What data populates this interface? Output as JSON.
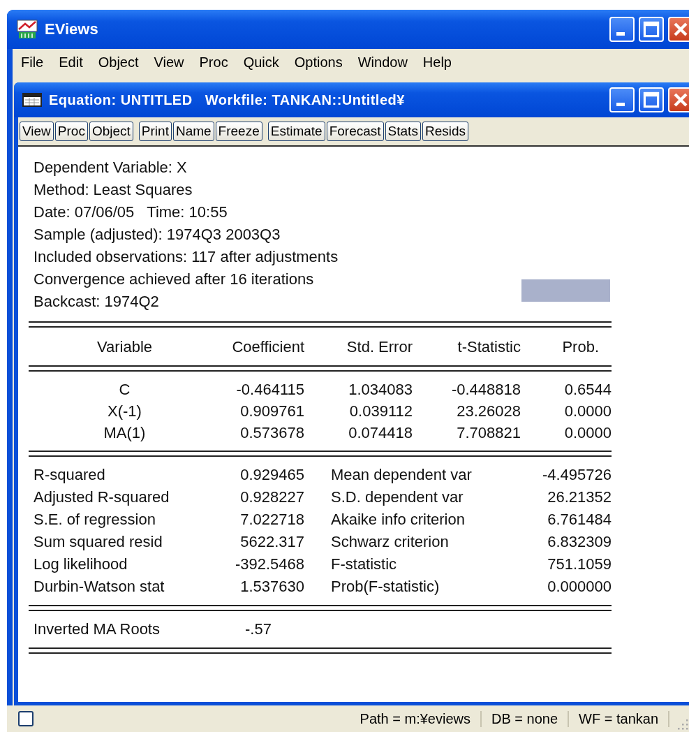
{
  "window": {
    "title": "EViews"
  },
  "menu": [
    {
      "label": "File"
    },
    {
      "label": "Edit"
    },
    {
      "label": "Object"
    },
    {
      "label": "View"
    },
    {
      "label": "Proc"
    },
    {
      "label": "Quick"
    },
    {
      "label": "Options"
    },
    {
      "label": "Window"
    },
    {
      "label": "Help"
    }
  ],
  "equation_window": {
    "title": "Equation: UNTITLED   Workfile: TANKAN::Untitled¥",
    "toolbar": [
      [
        "View",
        "Proc",
        "Object"
      ],
      [
        "Print",
        "Name",
        "Freeze"
      ],
      [
        "Estimate",
        "Forecast",
        "Stats",
        "Resids"
      ]
    ],
    "header_lines": [
      "Dependent Variable: X",
      "Method: Least Squares",
      "Date: 07/06/05   Time: 10:55",
      "Sample (adjusted): 1974Q3 2003Q3",
      "Included observations: 117 after adjustments",
      "Convergence achieved after 16 iterations",
      "Backcast: 1974Q2"
    ],
    "coefficients": {
      "columns": [
        "Variable",
        "Coefficient",
        "Std. Error",
        "t-Statistic",
        "Prob."
      ],
      "rows": [
        [
          "C",
          "-0.464115",
          "1.034083",
          "-0.448818",
          "0.6544"
        ],
        [
          "X(-1)",
          "0.909761",
          "0.039112",
          "23.26028",
          "0.0000"
        ],
        [
          "MA(1)",
          "0.573678",
          "0.074418",
          "7.708821",
          "0.0000"
        ]
      ]
    },
    "statistics": [
      {
        "label": "R-squared",
        "value": "0.929465",
        "label_2": "Mean dependent var",
        "value_2": "-4.495726"
      },
      {
        "label": "Adjusted R-squared",
        "value": "0.928227",
        "label_2": "S.D. dependent var",
        "value_2": "26.21352"
      },
      {
        "label": "S.E. of regression",
        "value": "7.022718",
        "label_2": "Akaike info criterion",
        "value_2": "6.761484"
      },
      {
        "label": "Sum squared resid",
        "value": "5622.317",
        "label_2": "Schwarz criterion",
        "value_2": "6.832309"
      },
      {
        "label": "Log likelihood",
        "value": "-392.5468",
        "label_2": "F-statistic",
        "value_2": "751.1059"
      },
      {
        "label": "Durbin-Watson stat",
        "value": "1.537630",
        "label_2": "Prob(F-statistic)",
        "value_2": "0.000000"
      }
    ],
    "roots": {
      "label": "Inverted MA Roots",
      "value": "-.57"
    }
  },
  "status_bar": {
    "checkbox": {
      "checked": false
    },
    "fields": [
      "Path = m:¥eviews",
      "DB = none",
      "WF = tankan"
    ]
  }
}
